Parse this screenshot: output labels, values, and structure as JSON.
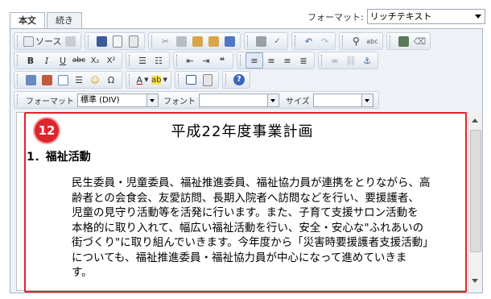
{
  "tabs": [
    {
      "label": "本文"
    },
    {
      "label": "続き"
    }
  ],
  "format_top": {
    "label": "フォーマット:",
    "value": "リッチテキスト"
  },
  "toolbar": {
    "source_label": "ソース",
    "format_label": "フォーマット",
    "format_value": "標準 (DIV)",
    "font_label": "フォント",
    "font_value": "",
    "size_label": "サイズ",
    "size_value": "",
    "bold": "B",
    "italic": "I",
    "underline": "U",
    "strike": "abc",
    "subscript": "X₂",
    "superscript": "X²",
    "omega": "Ω",
    "font_color": "A",
    "bg_color": "ab",
    "help": "?"
  },
  "document": {
    "title": "平成22年度事業計画",
    "heading": "1．福祉活動",
    "body": "民生委員・児童委員、福祉推進委員、福祉協力員が連携をとりながら、高\n齢者との会食会、友愛訪問、長期入院者へ訪問などを行い、要援護者、\n児童の見守り活動等を活発に行います。また、子育て支援サロン活動を\n本格的に取り入れて、幅広い福祉活動を行い、安全・安心な\"ふれあいの\n街づくり\"に取り組んでいきます。今年度から「災害時要援護者支援活動」\nについても、福祉推進委員・福祉協力員が中心になって進めていきま\nす。"
  },
  "annotation": {
    "badge": "12",
    "color": "#e0242b"
  }
}
